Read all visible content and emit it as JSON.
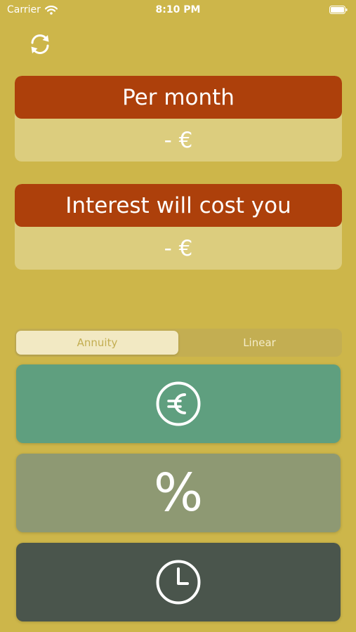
{
  "status_bar": {
    "carrier": "Carrier",
    "time": "8:10 PM"
  },
  "toolbar": {
    "refresh_icon": "refresh-icon"
  },
  "results": {
    "monthly": {
      "title": "Per month",
      "value": "- €"
    },
    "interest": {
      "title": "Interest will cost you",
      "value": "- €"
    }
  },
  "loan_type": {
    "options": [
      "Annuity",
      "Linear"
    ],
    "selected": "Annuity"
  },
  "inputs": {
    "amount": {
      "icon": "euro-circle-icon",
      "color": "#5f9f7f"
    },
    "rate": {
      "icon": "percent-icon",
      "glyph": "%",
      "color": "#8e9973"
    },
    "term": {
      "icon": "clock-icon",
      "color": "#4a554c"
    }
  },
  "colors": {
    "background": "#cdb64a",
    "header_accent": "#ad400b",
    "card_body": "#dccd7e"
  }
}
